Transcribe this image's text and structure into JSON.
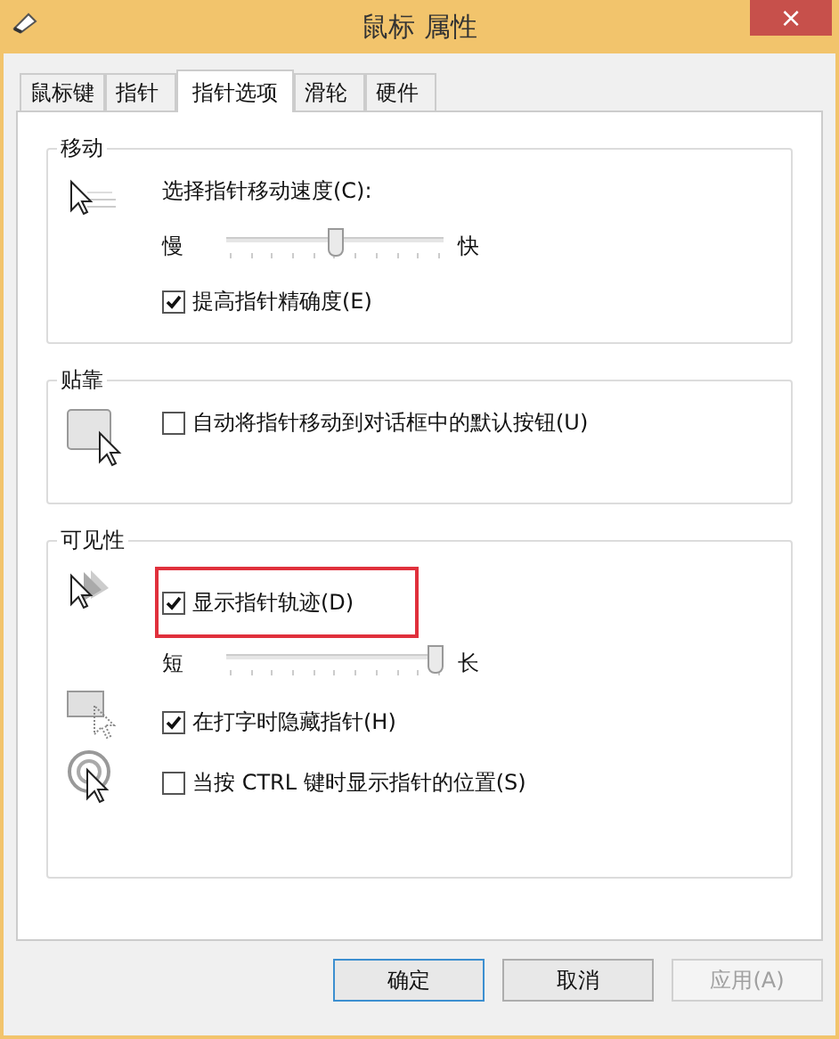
{
  "window": {
    "title": "鼠标 属性",
    "close": "×"
  },
  "tabs": [
    {
      "label": "鼠标键",
      "selected": false
    },
    {
      "label": "指针",
      "selected": false
    },
    {
      "label": "指针选项",
      "selected": true
    },
    {
      "label": "滑轮",
      "selected": false
    },
    {
      "label": "硬件",
      "selected": false
    }
  ],
  "groups": [
    {
      "title": "移动",
      "rows": [
        {
          "kind": "label",
          "label": "选择指针移动速度(C):"
        },
        {
          "kind": "slider",
          "left": "慢",
          "right": "快",
          "level": 0.5
        },
        {
          "kind": "checkbox",
          "label": "提高指针精确度(E)",
          "checked": true,
          "highlighted": false
        }
      ]
    },
    {
      "title": "贴靠",
      "rows": [
        {
          "kind": "checkbox",
          "label": "自动将指针移动到对话框中的默认按钮(U)",
          "checked": false,
          "highlighted": false
        }
      ]
    },
    {
      "title": "可见性",
      "rows": [
        {
          "kind": "checkbox",
          "label": "显示指针轨迹(D)",
          "checked": true,
          "highlighted": true
        },
        {
          "kind": "slider",
          "left": "短",
          "right": "长",
          "level": 1
        },
        {
          "kind": "checkbox",
          "label": "在打字时隐藏指针(H)",
          "checked": true,
          "highlighted": false
        },
        {
          "kind": "checkbox",
          "label": "当按 CTRL 键时显示指针的位置(S)",
          "checked": false,
          "highlighted": false
        }
      ]
    }
  ],
  "buttons": [
    {
      "label": "确定",
      "disabled": false,
      "default": true
    },
    {
      "label": "取消",
      "disabled": false,
      "default": false
    },
    {
      "label": "应用(A)",
      "disabled": true,
      "default": false
    }
  ]
}
